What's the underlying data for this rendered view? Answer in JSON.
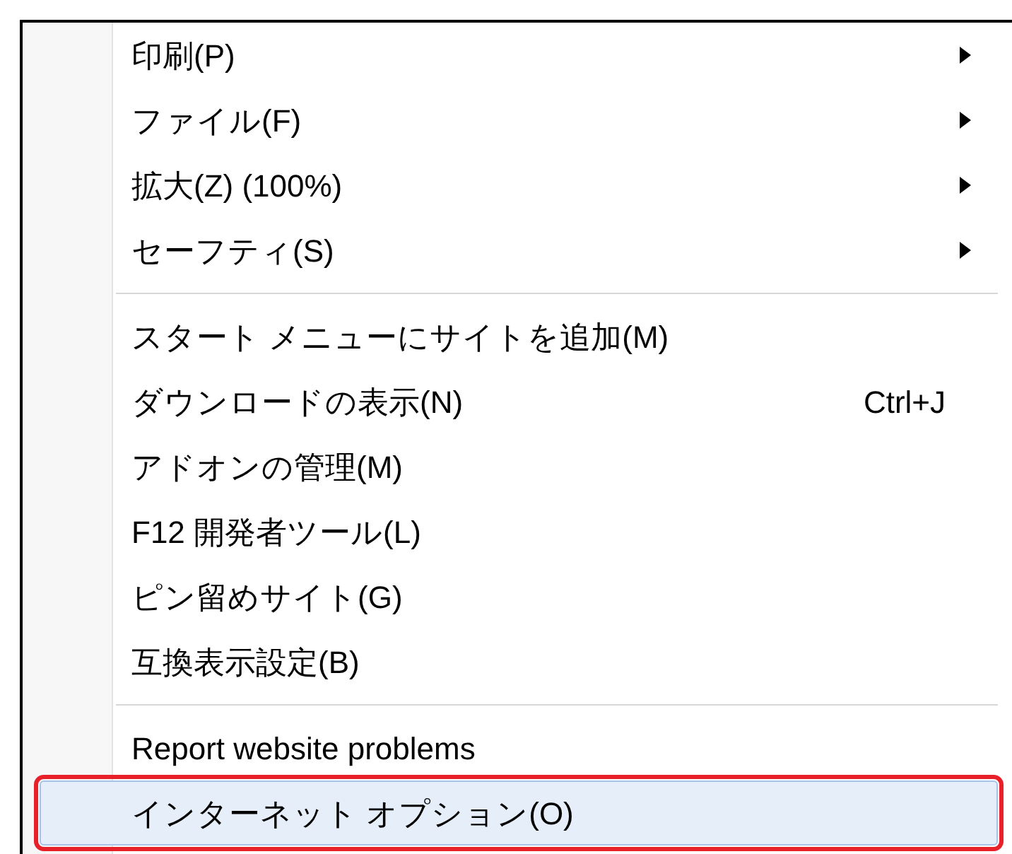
{
  "menu": {
    "sections": [
      {
        "items": [
          {
            "label": "印刷(P)",
            "submenu": true,
            "selected": false,
            "callout": false
          },
          {
            "label": "ファイル(F)",
            "submenu": true,
            "selected": false,
            "callout": false
          },
          {
            "label": "拡大(Z) (100%)",
            "submenu": true,
            "selected": false,
            "callout": false
          },
          {
            "label": "セーフティ(S)",
            "submenu": true,
            "selected": false,
            "callout": false
          }
        ]
      },
      {
        "items": [
          {
            "label": "スタート メニューにサイトを追加(M)",
            "submenu": false,
            "selected": false,
            "callout": false
          },
          {
            "label": "ダウンロードの表示(N)",
            "shortcut": "Ctrl+J",
            "submenu": false,
            "selected": false,
            "callout": false
          },
          {
            "label": "アドオンの管理(M)",
            "submenu": false,
            "selected": false,
            "callout": false
          },
          {
            "label": "F12 開発者ツール(L)",
            "submenu": false,
            "selected": false,
            "callout": false
          },
          {
            "label": "ピン留めサイト(G)",
            "submenu": false,
            "selected": false,
            "callout": false
          },
          {
            "label": "互換表示設定(B)",
            "submenu": false,
            "selected": false,
            "callout": false
          }
        ]
      },
      {
        "items": [
          {
            "label": "Report website problems",
            "submenu": false,
            "selected": false,
            "callout": false
          },
          {
            "label": "インターネット オプション(O)",
            "submenu": false,
            "selected": true,
            "callout": true
          }
        ]
      }
    ]
  }
}
